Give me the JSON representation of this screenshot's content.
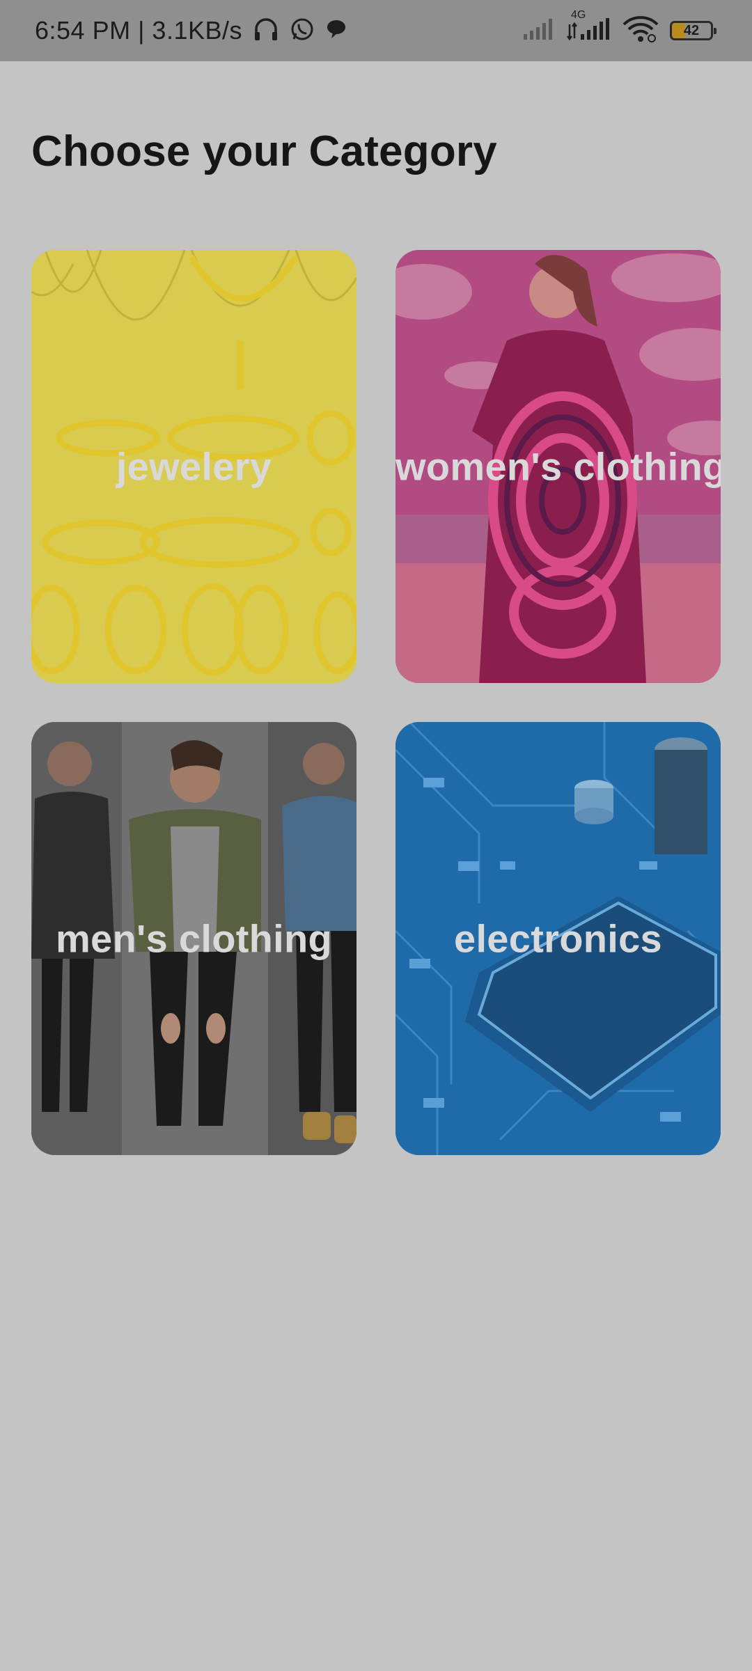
{
  "status_bar": {
    "time_and_speed": "6:54 PM | 3.1KB/s",
    "network_type": "4G",
    "battery_level": "42",
    "icons": [
      "headphones-icon",
      "whatsapp-icon",
      "chat-bubble-icon",
      "signal-icon",
      "signal-4g-icon",
      "wifi-icon",
      "battery-icon"
    ]
  },
  "page": {
    "title": "Choose your Category"
  },
  "categories": [
    {
      "label": "jewelery",
      "color": "#d8cb50"
    },
    {
      "label": "women's clothing",
      "color": "#b94b7b"
    },
    {
      "label": "men's clothing",
      "color": "#5a5a5a"
    },
    {
      "label": "electronics",
      "color": "#1f6aa8"
    }
  ],
  "colors": {
    "background": "#c4c4c4",
    "status_bar": "#8f8f8f",
    "title": "#161616",
    "card_label": "#d9d9d9"
  }
}
